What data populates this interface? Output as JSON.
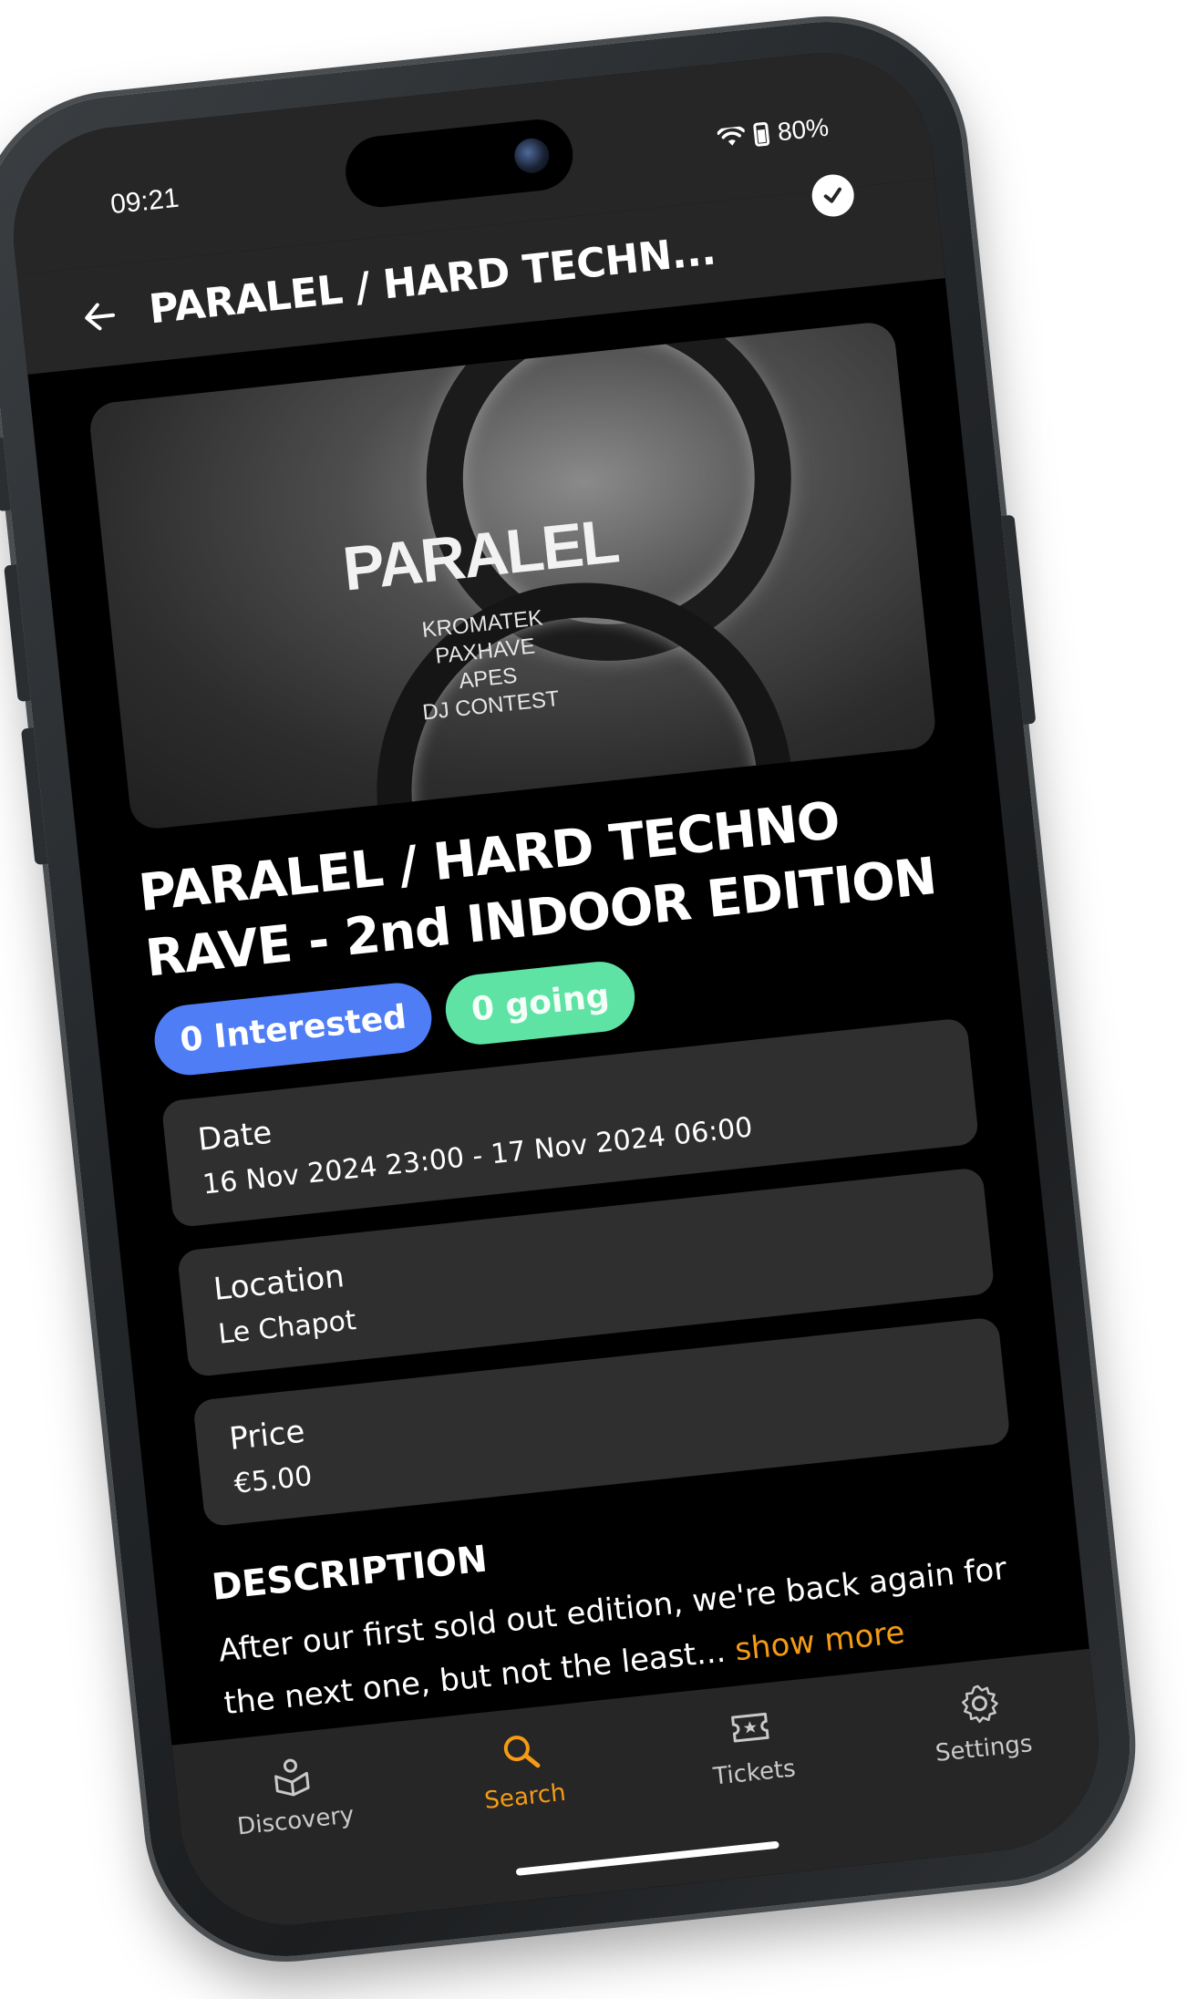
{
  "status_bar": {
    "time": "09:21",
    "battery": "80%"
  },
  "app_bar": {
    "title": "PARALEL / HARD TECHN..."
  },
  "poster": {
    "title": "PARALEL",
    "lineup": [
      "KROMATEK",
      "PAXHAVE",
      "APES",
      "DJ CONTEST"
    ]
  },
  "event": {
    "title": "PARALEL / HARD TECHNO RAVE - 2nd INDOOR EDITION",
    "interested_label": "0 Interested",
    "going_label": "0 going"
  },
  "details": [
    {
      "label": "Date",
      "value": "16 Nov 2024 23:00 - 17 Nov 2024 06:00"
    },
    {
      "label": "Location",
      "value": "Le Chapot"
    },
    {
      "label": "Price",
      "value": "€5.00"
    }
  ],
  "description": {
    "heading": "DESCRIPTION",
    "text": "After our first sold out edition, we're back again for the next one, but not the least...",
    "show_more": "show more"
  },
  "bottom_nav": [
    {
      "label": "Discovery",
      "icon": "discovery-icon",
      "active": false
    },
    {
      "label": "Search",
      "icon": "search-icon",
      "active": true
    },
    {
      "label": "Tickets",
      "icon": "ticket-icon",
      "active": false
    },
    {
      "label": "Settings",
      "icon": "gear-icon",
      "active": false
    }
  ],
  "colors": {
    "accent": "#f59b15",
    "interested": "#4e7df5",
    "going": "#5fe3a4",
    "card": "#2f2f2f",
    "bar": "#262626"
  }
}
